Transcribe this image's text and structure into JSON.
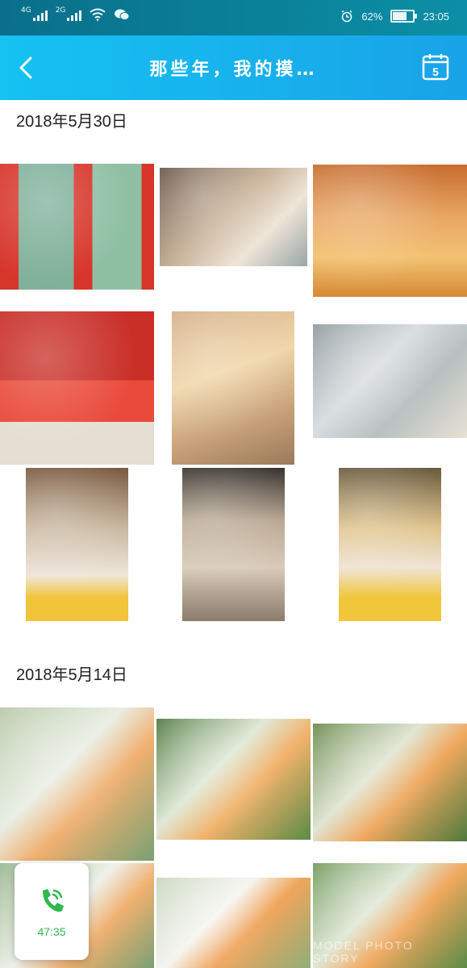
{
  "status": {
    "net1": "4G",
    "net2": "2G",
    "battery": "62%",
    "battery_level": 0.62,
    "time": "23:05"
  },
  "header": {
    "title": "那些年，我的摸…",
    "calendar_day": "5"
  },
  "sections": [
    {
      "date": "2018年5月30日"
    },
    {
      "date": "2018年5月14日"
    }
  ],
  "call": {
    "duration": "47:35"
  },
  "watermark": "MODEL PHOTO STORY",
  "colors": {
    "appbar": "#15c2f2",
    "statusbar": "#0a6f8a",
    "call_green": "#2fb84e"
  }
}
